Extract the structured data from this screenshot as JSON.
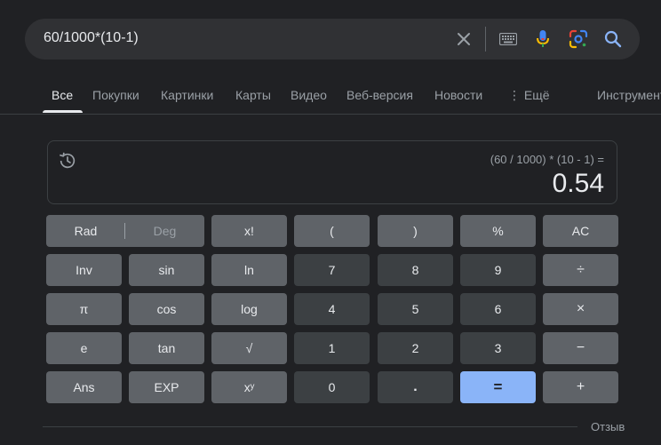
{
  "search": {
    "query": "60/1000*(10-1)",
    "icons": [
      "clear-icon",
      "keyboard-icon",
      "microphone-icon",
      "lens-icon",
      "search-icon"
    ]
  },
  "tabs": [
    {
      "label": "Все",
      "active": true
    },
    {
      "label": "Покупки"
    },
    {
      "label": "Картинки"
    },
    {
      "label": "Карты"
    },
    {
      "label": "Видео"
    },
    {
      "label": "Веб-версия"
    },
    {
      "label": "Новости"
    },
    {
      "label": "Ещё"
    },
    {
      "label": "Инструменты"
    }
  ],
  "calculator": {
    "expression": "(60 / 1000) * (10 - 1) =",
    "result": "0.54",
    "mode": {
      "rad": "Rad",
      "deg": "Deg",
      "selected": "Rad"
    },
    "keys": {
      "fact": "x!",
      "lparen": "(",
      "rparen": ")",
      "percent": "%",
      "ac": "AC",
      "inv": "Inv",
      "sin": "sin",
      "ln": "ln",
      "seven": "7",
      "eight": "8",
      "nine": "9",
      "divide": "÷",
      "pi": "π",
      "cos": "cos",
      "log": "log",
      "four": "4",
      "five": "5",
      "six": "6",
      "multiply": "×",
      "e": "e",
      "tan": "tan",
      "sqrt": "√",
      "one": "1",
      "two": "2",
      "three": "3",
      "minus": "−",
      "ans": "Ans",
      "exp": "EXP",
      "pow": "xʸ",
      "zero": "0",
      "dot": ".",
      "equals": "=",
      "plus": "+"
    }
  },
  "footer": {
    "feedback": "Отзыв"
  },
  "colors": {
    "background": "#202124",
    "fn_key": "#5f6368",
    "num_key": "#3c4043",
    "accent": "#8ab4f8"
  }
}
